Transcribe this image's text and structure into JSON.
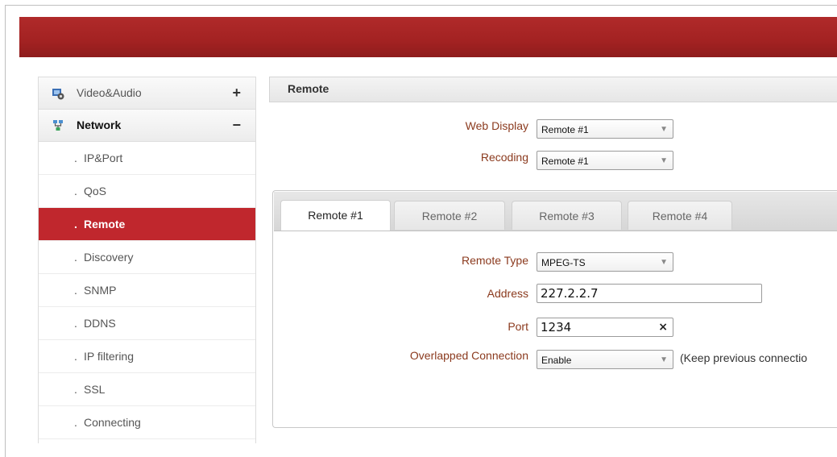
{
  "sidebar": {
    "groups": [
      {
        "label": "Video&Audio",
        "toggle": "+",
        "icon": "video-audio-icon"
      },
      {
        "label": "Network",
        "toggle": "−",
        "icon": "network-icon"
      }
    ],
    "items": [
      {
        "label": "IP&Port"
      },
      {
        "label": "QoS"
      },
      {
        "label": "Remote"
      },
      {
        "label": "Discovery"
      },
      {
        "label": "SNMP"
      },
      {
        "label": "DDNS"
      },
      {
        "label": "IP filtering"
      },
      {
        "label": "SSL"
      },
      {
        "label": "Connecting"
      }
    ],
    "bullet": "."
  },
  "main": {
    "title": "Remote",
    "web_display": {
      "label": "Web Display",
      "value": "Remote #1"
    },
    "recoding": {
      "label": "Recoding",
      "value": "Remote #1"
    },
    "tabs": [
      {
        "label": "Remote #1"
      },
      {
        "label": "Remote #2"
      },
      {
        "label": "Remote #3"
      },
      {
        "label": "Remote #4"
      }
    ],
    "remote_type": {
      "label": "Remote Type",
      "value": "MPEG-TS"
    },
    "address": {
      "label": "Address",
      "value": "227.2.2.7"
    },
    "port": {
      "label": "Port",
      "value": "1234",
      "clear": "×"
    },
    "overlapped": {
      "label": "Overlapped Connection",
      "value": "Enable",
      "hint": "(Keep previous connectio"
    },
    "dropdown_arrow": "▼"
  },
  "colors": {
    "header": "#a32222",
    "selected": "#c0272d",
    "label": "#8b3a1e"
  }
}
